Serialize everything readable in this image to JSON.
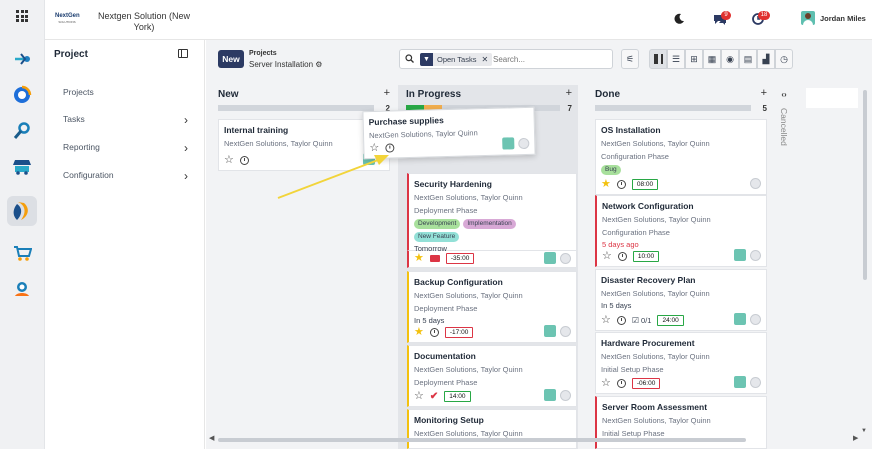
{
  "topbar": {
    "company_name": "Nextgen Solution (New York)",
    "logo_text": "NextGen",
    "chat_count": "9",
    "activity_count": "18",
    "user_name": "Jordan Miles"
  },
  "sidebar": {
    "title": "Project",
    "items": [
      {
        "label": "Projects",
        "has_children": false
      },
      {
        "label": "Tasks",
        "has_children": true
      },
      {
        "label": "Reporting",
        "has_children": true
      },
      {
        "label": "Configuration",
        "has_children": true
      }
    ]
  },
  "control": {
    "new_label": "New",
    "breadcrumb_parent": "Projects",
    "breadcrumb_current": "Server Installation",
    "facet_label": "Open Tasks",
    "search_placeholder": "Search..."
  },
  "columns": [
    {
      "title": "New",
      "count": "2"
    },
    {
      "title": "In Progress",
      "count": "7"
    },
    {
      "title": "Done",
      "count": "5"
    },
    {
      "title": "Cancelled"
    }
  ],
  "cards": {
    "internal_training": {
      "title": "Internal training",
      "subtitle": "NextGen Solutions, Taylor Quinn"
    },
    "purchase_supplies": {
      "title": "Purchase supplies",
      "subtitle": "NextGen Solutions, Taylor Quinn"
    },
    "security_hardening": {
      "title": "Security Hardening",
      "subtitle": "NextGen Solutions, Taylor Quinn",
      "phase": "Deployment Phase",
      "tags": [
        "Development",
        "Implementation",
        "New Feature"
      ],
      "due": "Tomorrow",
      "badge": "-35:00"
    },
    "backup_configuration": {
      "title": "Backup Configuration",
      "subtitle": "NextGen Solutions, Taylor Quinn",
      "phase": "Deployment Phase",
      "due": "In 5 days",
      "badge": "-17:00"
    },
    "documentation": {
      "title": "Documentation",
      "subtitle": "NextGen Solutions, Taylor Quinn",
      "phase": "Deployment Phase",
      "badge": "14:00"
    },
    "monitoring_setup": {
      "title": "Monitoring Setup",
      "subtitle": "NextGen Solutions, Taylor Quinn"
    },
    "os_installation": {
      "title": "OS Installation",
      "subtitle": "NextGen Solutions, Taylor Quinn",
      "phase": "Configuration Phase",
      "tag": "Bug",
      "badge": "08:00"
    },
    "network_configuration": {
      "title": "Network Configuration",
      "subtitle": "NextGen Solutions, Taylor Quinn",
      "phase": "Configuration Phase",
      "due": "5 days ago",
      "badge": "10:00"
    },
    "disaster_recovery": {
      "title": "Disaster Recovery Plan",
      "subtitle": "NextGen Solutions, Taylor Quinn",
      "due": "In 5 days",
      "checklist": "0/1",
      "badge": "24:00"
    },
    "hardware_procurement": {
      "title": "Hardware Procurement",
      "subtitle": "NextGen Solutions, Taylor Quinn",
      "phase": "Initial Setup Phase",
      "badge": "-06:00"
    },
    "server_room_assessment": {
      "title": "Server Room Assessment",
      "subtitle": "NextGen Solutions, Taylor Quinn",
      "phase": "Initial Setup Phase"
    }
  },
  "colors": {
    "primary": "#2c3a63",
    "progress_green": "#28a745",
    "progress_orange": "#f0ad4e",
    "star_gold": "#f3c10e",
    "overdue_red": "#dc3545",
    "arrow_yellow": "#f2d43a"
  }
}
